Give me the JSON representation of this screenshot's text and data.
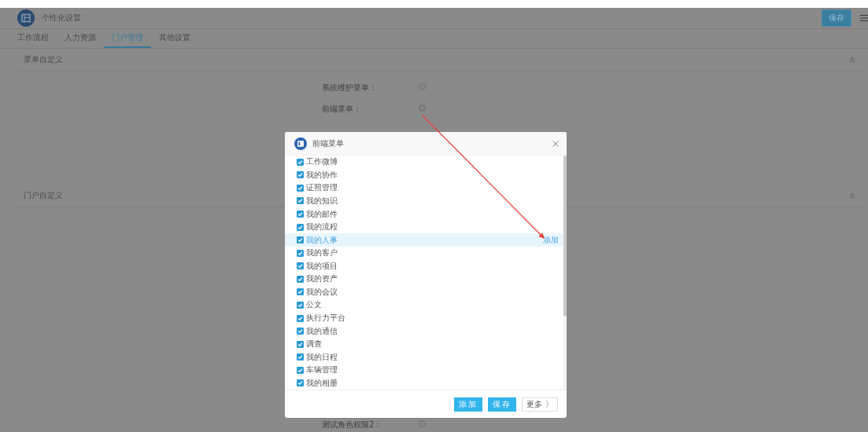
{
  "header": {
    "title": "个性化设置",
    "save_button": "保存"
  },
  "tabs": [
    {
      "label": "工作流程",
      "selected": false
    },
    {
      "label": "人力资源",
      "selected": false
    },
    {
      "label": "门户管理",
      "selected": true
    },
    {
      "label": "其他设置",
      "selected": false
    }
  ],
  "sections": [
    {
      "title": "菜单自定义",
      "fields": [
        {
          "label": "系统维护菜单："
        },
        {
          "label": "前端菜单："
        }
      ]
    },
    {
      "title": "门户自定义",
      "fields": [
        {
          "label": "测试角色权限2："
        }
      ]
    }
  ],
  "dialog": {
    "title": "前端菜单",
    "items": [
      {
        "label": "工作微博",
        "checked": true,
        "selected": false
      },
      {
        "label": "我的协作",
        "checked": true,
        "selected": false
      },
      {
        "label": "证照管理",
        "checked": true,
        "selected": false
      },
      {
        "label": "我的知识",
        "checked": true,
        "selected": false
      },
      {
        "label": "我的邮件",
        "checked": true,
        "selected": false
      },
      {
        "label": "我的流程",
        "checked": true,
        "selected": false
      },
      {
        "label": "我的人事",
        "checked": true,
        "selected": true,
        "action": "添加"
      },
      {
        "label": "我的客户",
        "checked": true,
        "selected": false
      },
      {
        "label": "我的项目",
        "checked": true,
        "selected": false
      },
      {
        "label": "我的资产",
        "checked": true,
        "selected": false
      },
      {
        "label": "我的会议",
        "checked": true,
        "selected": false
      },
      {
        "label": "公文",
        "checked": true,
        "selected": false
      },
      {
        "label": "执行力平台",
        "checked": true,
        "selected": false
      },
      {
        "label": "我的通信",
        "checked": true,
        "selected": false
      },
      {
        "label": "调查",
        "checked": true,
        "selected": false
      },
      {
        "label": "我的日程",
        "checked": true,
        "selected": false
      },
      {
        "label": "车辆管理",
        "checked": true,
        "selected": false
      },
      {
        "label": "我的相册",
        "checked": true,
        "selected": false
      }
    ],
    "buttons": [
      {
        "label": "添加",
        "kind": "primary"
      },
      {
        "label": "保存",
        "kind": "primary"
      },
      {
        "label": "更多",
        "kind": "more",
        "icon": "》"
      }
    ]
  }
}
